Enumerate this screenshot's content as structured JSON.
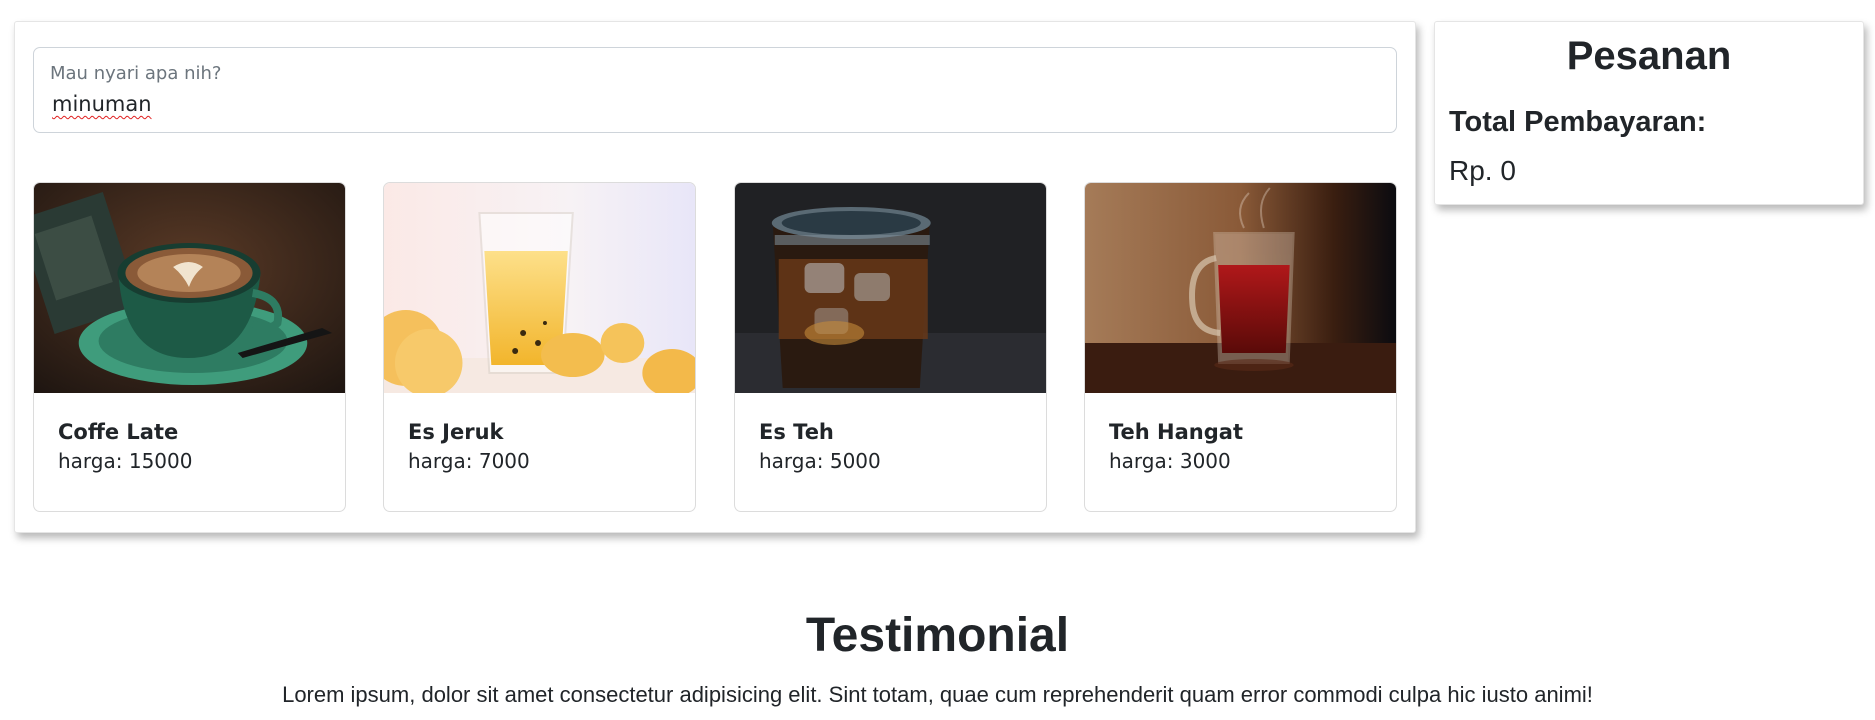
{
  "search": {
    "label": "Mau nyari apa nih?",
    "value": "minuman"
  },
  "menu": {
    "items": [
      {
        "name": "Coffe Late",
        "price": "harga: 15000",
        "image": "coffee-latte-image"
      },
      {
        "name": "Es Jeruk",
        "price": "harga: 7000",
        "image": "orange-juice-image"
      },
      {
        "name": "Es Teh",
        "price": "harga: 5000",
        "image": "iced-tea-image"
      },
      {
        "name": "Teh Hangat",
        "price": "harga: 3000",
        "image": "hot-tea-image"
      }
    ]
  },
  "order": {
    "title": "Pesanan",
    "total_label": "Total Pembayaran:",
    "total_value": "Rp. 0"
  },
  "testimonial": {
    "title": "Testimonial",
    "text": "Lorem ipsum, dolor sit amet consectetur adipisicing elit. Sint totam, quae cum reprehenderit quam error commodi culpa hic iusto animi!"
  },
  "colors": {
    "text": "#212529",
    "muted": "#6c757d",
    "border": "#ced4da"
  }
}
